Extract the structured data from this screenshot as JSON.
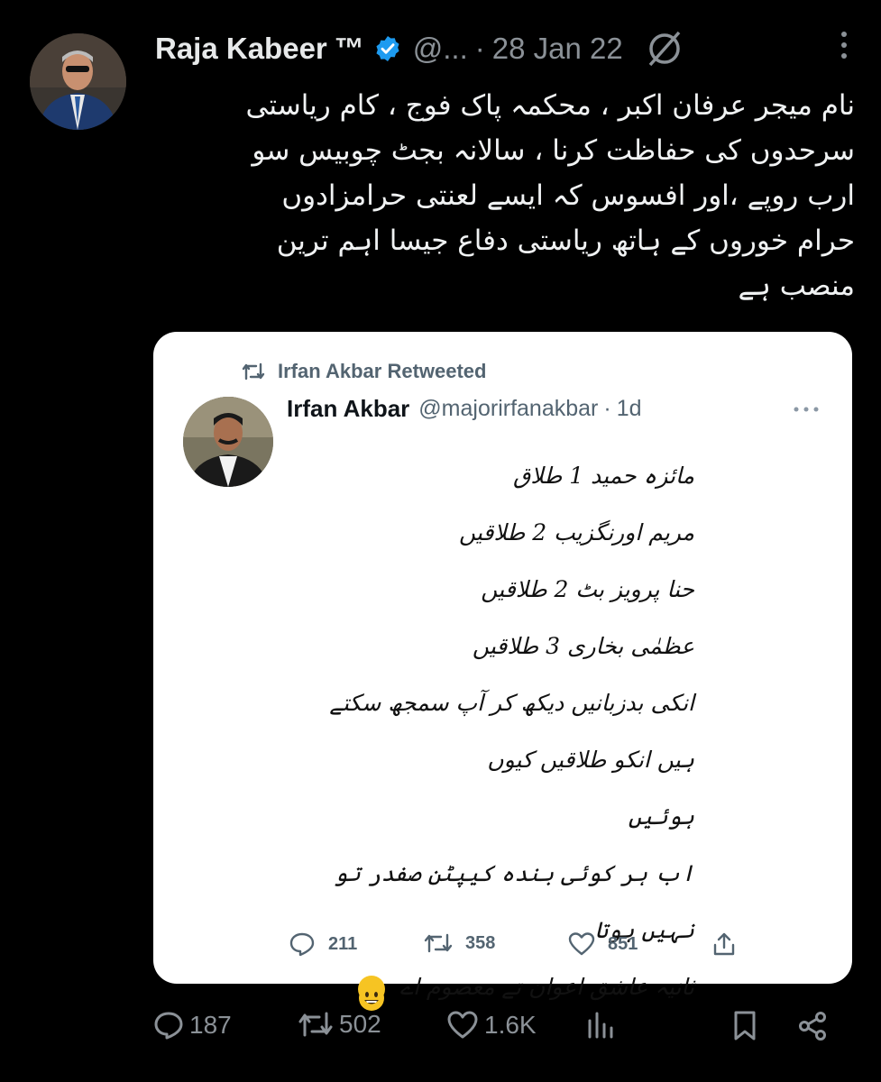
{
  "tweet": {
    "author": {
      "name": "Raja Kabeer",
      "trademark": "™",
      "handle": "@...",
      "separator": "·",
      "date": "28 Jan 22"
    },
    "text_lines": [
      "نام میجر عرفان اکبر ، محکمہ پاک فوج ، کام ریاستی",
      "سرحدوں کی حفاظت کرنا ، سالانہ بجٹ چوبیس سو",
      "ارب روپے ،اور افسوس کہ ایسے لعنتی حرامزادوں",
      "حرام خوروں کے ہاتھ ریاستی دفاع جیسا اہم ترین",
      "منصب ہے"
    ],
    "metrics": {
      "replies": "187",
      "retweets": "502",
      "likes": "1.6K"
    }
  },
  "quoted": {
    "retweet_label": "Irfan Akbar Retweeted",
    "author": {
      "name": "Irfan Akbar",
      "handle": "@majorirfanakbar",
      "separator": "·",
      "time": "1d"
    },
    "lines": [
      "مائزہ حمید 1 طلاق",
      "مریم اورنگزیب 2 طلاقیں",
      "حنا پرویز بٹ 2 طلاقیں",
      "عظمٰی بخاری 3 طلاقیں",
      "انکی بدزبانیں دیکھ کر آپ سمجھ سکتے ہیں انکو طلاقیں کیوں",
      "ہوئیں",
      "اب ہر کوئی بندہ کیپٹن صفدر تو نہیں ہوتا",
      "ثانیہ عاشق اعوان تے معصوم اے"
    ],
    "metrics": {
      "replies": "211",
      "retweets": "358",
      "likes": "851"
    }
  },
  "icons": {
    "verified_color": "#1d9bf0",
    "emoji": "grinning-face"
  }
}
